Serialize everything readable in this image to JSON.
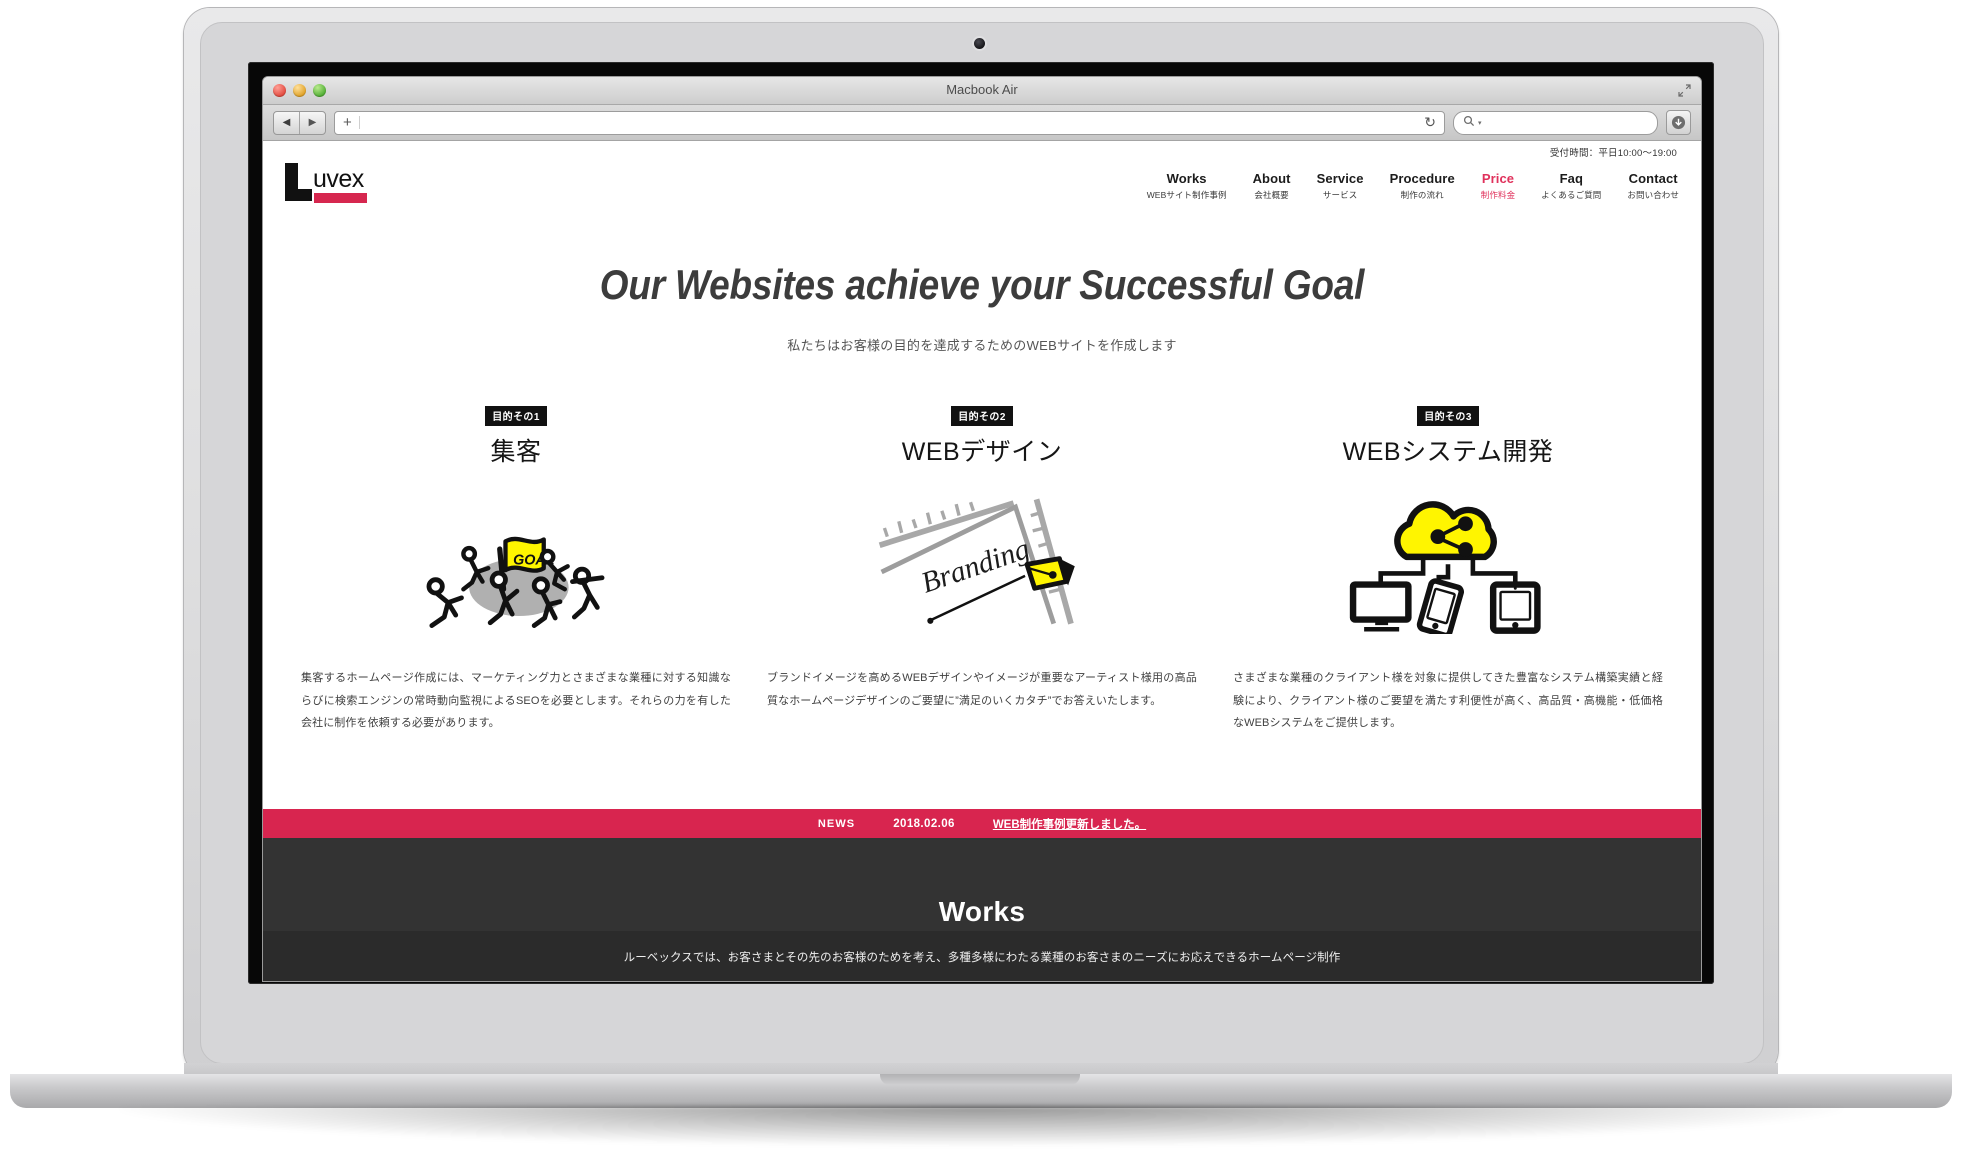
{
  "window": {
    "title": "Macbook Air",
    "url_value": "",
    "url_placeholder": "",
    "search_value": "",
    "search_placeholder": "",
    "back_icon": "back-arrow-icon",
    "forward_icon": "forward-arrow-icon",
    "plus_icon": "+",
    "reload_icon": "↻",
    "search_icon": "⌕",
    "caret_icon": "▾",
    "download_icon": "▼",
    "fullscreen_icon": "⤡"
  },
  "site": {
    "hours": "受付時間：平日10:00～19:00",
    "logo": {
      "letter": "L",
      "word": "uvex",
      "bar_color": "#d6274f"
    },
    "nav": [
      {
        "en": "Works",
        "jp": "WEBサイト制作事例",
        "accent": false
      },
      {
        "en": "About",
        "jp": "会社概要",
        "accent": false
      },
      {
        "en": "Service",
        "jp": "サービス",
        "accent": false
      },
      {
        "en": "Procedure",
        "jp": "制作の流れ",
        "accent": false
      },
      {
        "en": "Price",
        "jp": "制作料金",
        "accent": true
      },
      {
        "en": "Faq",
        "jp": "よくあるご質問",
        "accent": false
      },
      {
        "en": "Contact",
        "jp": "お問い合わせ",
        "accent": false
      }
    ]
  },
  "hero": {
    "title": "Our Websites achieve your Successful Goal",
    "subtitle": "私たちはお客様の目的を達成するためのWEBサイトを作成します"
  },
  "columns": [
    {
      "badge": "目的その1",
      "title": "集客",
      "illustration": "goal-flag-runners-illustration",
      "flag_label": "GOAL",
      "body": "集客するホームページ作成には、マーケティング力とさまざまな業種に対する知識ならびに検索エンジンの常時動向監視によるSEOを必要とします。それらの力を有した会社に制作を依頼する必要があります。"
    },
    {
      "badge": "目的その2",
      "title": "WEBデザイン",
      "illustration": "branding-pen-ruler-illustration",
      "script_label": "Branding",
      "body": "ブランドイメージを高めるWEBデザインやイメージが重要なアーティスト様用の高品質なホームページデザインのご要望に”満足のいくカタチ”でお答えいたします。"
    },
    {
      "badge": "目的その3",
      "title": "WEBシステム開発",
      "illustration": "cloud-devices-illustration",
      "body": "さまざまな業種のクライアント様を対象に提供してきた豊富なシステム構築実績と経験により、クライアント様のご要望を満たす利便性が高く、高品質・高機能・低価格なWEBシステムをご提供します。"
    }
  ],
  "news": {
    "label": "NEWS",
    "date": "2018.02.06",
    "link": "WEB制作事例更新しました。"
  },
  "works": {
    "title": "Works"
  },
  "footer": {
    "note": "ルーベックスでは、お客さまとその先のお客様のためを考え、多種多様にわたる業種のお客さまのニーズにお応えできるホームページ制作"
  },
  "colors": {
    "accent": "#d8254f",
    "dark": "#333333",
    "yellow": "#fff500"
  }
}
